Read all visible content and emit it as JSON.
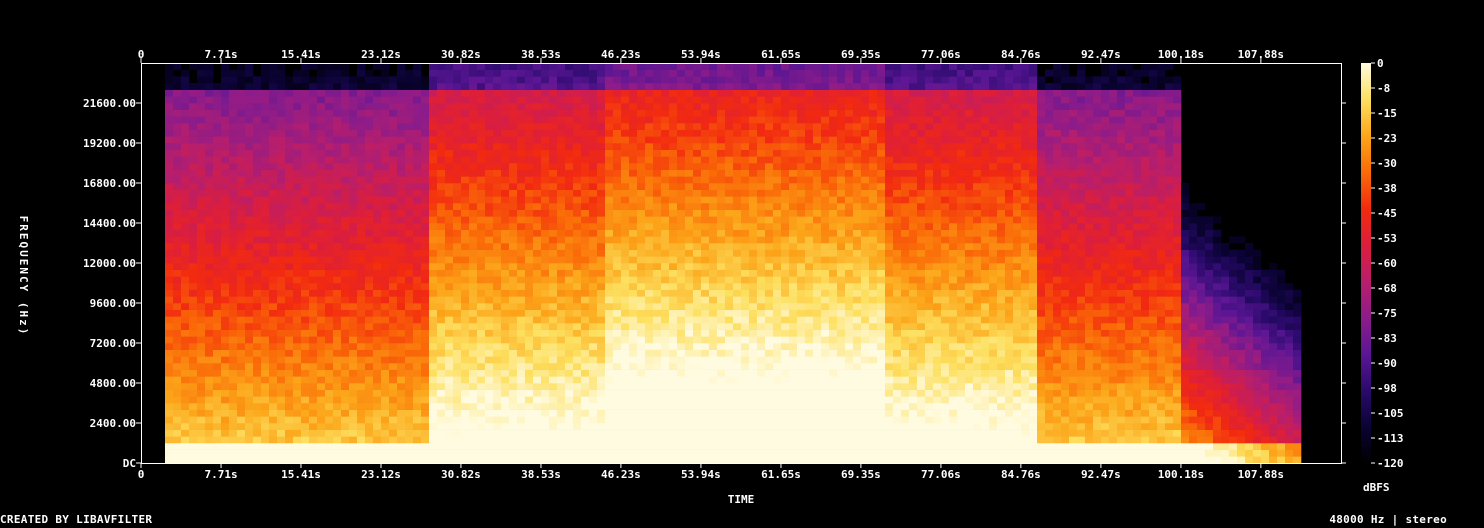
{
  "chart_data": {
    "type": "heatmap",
    "title": "",
    "xlabel": "TIME",
    "ylabel": "FREQUENCY (Hz)",
    "colorbar_label": "dBFS",
    "x_ticks": [
      "0",
      "7.71s",
      "15.41s",
      "23.12s",
      "30.82s",
      "38.53s",
      "46.23s",
      "53.94s",
      "61.65s",
      "69.35s",
      "77.06s",
      "84.76s",
      "92.47s",
      "100.18s",
      "107.88s"
    ],
    "x_tick_values": [
      0,
      7.71,
      15.41,
      23.12,
      30.82,
      38.53,
      46.23,
      53.94,
      61.65,
      69.35,
      77.06,
      84.76,
      92.47,
      100.18,
      107.88
    ],
    "xlim": [
      0,
      115.6
    ],
    "y_ticks": [
      "DC",
      "2400.00",
      "4800.00",
      "7200.00",
      "9600.00",
      "12000.00",
      "14400.00",
      "16800.00",
      "19200.00",
      "21600.00"
    ],
    "y_tick_values": [
      0,
      2400,
      4800,
      7200,
      9600,
      12000,
      14400,
      16800,
      19200,
      21600
    ],
    "ylim": [
      0,
      24000
    ],
    "colorbar_ticks": [
      "0",
      "-8",
      "-15",
      "-23",
      "-30",
      "-38",
      "-45",
      "-53",
      "-60",
      "-68",
      "-75",
      "-83",
      "-90",
      "-98",
      "-105",
      "-113",
      "-120"
    ],
    "colorbar_range": [
      -120,
      0
    ],
    "audio_start_s": 2.0,
    "audio_end_s": 112.0,
    "colors": [
      "#000000",
      "#0a0333",
      "#2a0a6b",
      "#5a1694",
      "#8c1c8a",
      "#b81e6b",
      "#dc1e3c",
      "#f22a10",
      "#fa6a08",
      "#fca61a",
      "#fde060",
      "#fffbe0"
    ]
  },
  "footer": {
    "left": "CREATED BY LIBAVFILTER",
    "right": "48000 Hz | stereo"
  }
}
